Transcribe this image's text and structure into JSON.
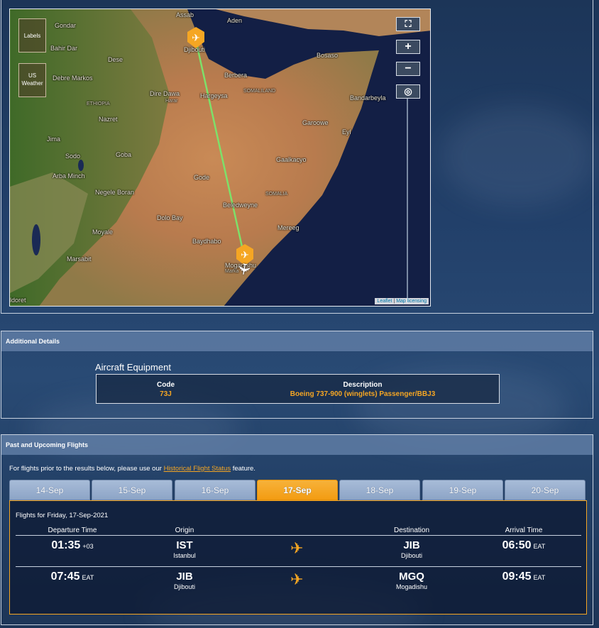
{
  "map": {
    "labels_button": "Labels",
    "weather_button_line1": "US",
    "weather_button_line2": "Weather",
    "zoom_fullscreen": "⛶",
    "zoom_in": "+",
    "zoom_out": "−",
    "locate": "◎",
    "attribution_leaflet": "Leaflet",
    "attribution_sep": "|",
    "attribution_license": "Map licensing",
    "place_names": [
      "Assab",
      "Aden",
      "Gondar",
      "Djibouti",
      "Bahir Dar",
      "Dese",
      "Bosaso",
      "Debre Markos",
      "Berbera",
      "Dire Dawa",
      "Harar",
      "Hargeysa",
      "SOMALILAND",
      "Bandarbeyla",
      "ETHIOPIA",
      "Nazret",
      "Garoowe",
      "Eyl",
      "Jima",
      "Sodo",
      "Goba",
      "Gaalkacyo",
      "Arba Minch",
      "Gode",
      "Negele Boran",
      "SOMALIA",
      "Beledweyne",
      "Dolo Bay",
      "Mereeg",
      "Moyale",
      "Baydhabo",
      "Marsabit",
      "Mogadishu",
      "Marka",
      "ldoret"
    ],
    "small_place_names": [
      "SOMALILAND",
      "ETHIOPIA",
      "SOMALIA",
      "Harar"
    ]
  },
  "details": {
    "header": "Additional Details",
    "equipment_title": "Aircraft Equipment",
    "code_header": "Code",
    "code_value": "73J",
    "description_header": "Description",
    "description_value": "Boeing 737-900 (winglets) Passenger/BBJ3"
  },
  "flights": {
    "header": "Past and Upcoming Flights",
    "note_prefix": "For flights prior to the results below, please use our ",
    "note_link": "Historical Flight Status",
    "note_suffix": " feature.",
    "tabs": [
      "14-Sep",
      "15-Sep",
      "16-Sep",
      "17-Sep",
      "18-Sep",
      "19-Sep",
      "20-Sep"
    ],
    "active_tab": "17-Sep",
    "date_heading": "Flights for Friday, 17-Sep-2021",
    "columns": {
      "departure": "Departure Time",
      "origin": "Origin",
      "destination": "Destination",
      "arrival": "Arrival Time"
    },
    "rows": [
      {
        "dep_time": "01:35",
        "dep_tz": "+03",
        "origin_code": "IST",
        "origin_city": "Istanbul",
        "dest_code": "JIB",
        "dest_city": "Djibouti",
        "arr_time": "06:50",
        "arr_tz": "EAT"
      },
      {
        "dep_time": "07:45",
        "dep_tz": "EAT",
        "origin_code": "JIB",
        "origin_city": "Djibouti",
        "dest_code": "MGQ",
        "dest_city": "Mogadishu",
        "arr_time": "09:45",
        "arr_tz": "EAT"
      }
    ]
  },
  "colors": {
    "accent": "#f5a623",
    "route_line": "#7ee06a",
    "header_bar": "#5f7da5"
  }
}
